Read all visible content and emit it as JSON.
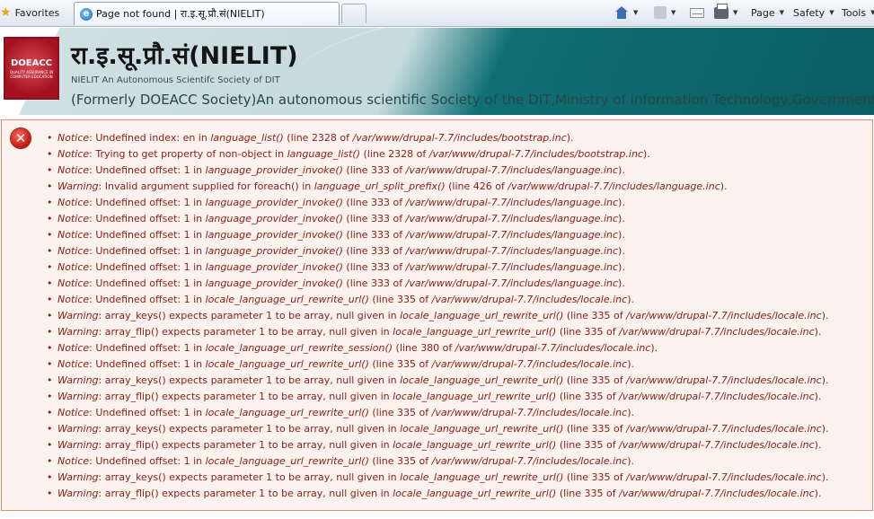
{
  "browser": {
    "favorites_label": "Favorites",
    "tab_title": "Page not found | रा.इ.सू.प्रौ.सं(NIELIT)",
    "commands": {
      "page_label": "Page",
      "safety_label": "Safety",
      "tools_label": "Tools"
    }
  },
  "site": {
    "logo_text": "DOEACC",
    "logo_subtext": "QUALITY ASSURANCE IN COMPUTER EDUCATION",
    "title": "रा.इ.सू.प्रौ.सं(NIELIT)",
    "slogan": "NIELIT An Autonomous Scientifc Society of DIT",
    "description": "(Formerly DOEACC Society)An autonomous scientific Society of the DIT,Ministry of Information Technology,Government of In"
  },
  "error_messages": [
    {
      "level": "Notice",
      "text": ": Undefined index: en in ",
      "func": "language_list()",
      "loc": " (line ",
      "line": "2328",
      "of": " of ",
      "file": "/var/www/drupal-7.7/includes/bootstrap.inc",
      "end": ")."
    },
    {
      "level": "Notice",
      "text": ": Trying to get property of non-object in ",
      "func": "language_list()",
      "loc": " (line ",
      "line": "2328",
      "of": " of ",
      "file": "/var/www/drupal-7.7/includes/bootstrap.inc",
      "end": ")."
    },
    {
      "level": "Notice",
      "text": ": Undefined offset: 1 in ",
      "func": "language_provider_invoke()",
      "loc": " (line ",
      "line": "333",
      "of": " of ",
      "file": "/var/www/drupal-7.7/includes/language.inc",
      "end": ")."
    },
    {
      "level": "Warning",
      "text": ": Invalid argument supplied for foreach() in ",
      "func": "language_url_split_prefix()",
      "loc": " (line ",
      "line": "426",
      "of": " of ",
      "file": "/var/www/drupal-7.7/includes/language.inc",
      "end": ")."
    },
    {
      "level": "Notice",
      "text": ": Undefined offset: 1 in ",
      "func": "language_provider_invoke()",
      "loc": " (line ",
      "line": "333",
      "of": " of ",
      "file": "/var/www/drupal-7.7/includes/language.inc",
      "end": ")."
    },
    {
      "level": "Notice",
      "text": ": Undefined offset: 1 in ",
      "func": "language_provider_invoke()",
      "loc": " (line ",
      "line": "333",
      "of": " of ",
      "file": "/var/www/drupal-7.7/includes/language.inc",
      "end": ")."
    },
    {
      "level": "Notice",
      "text": ": Undefined offset: 1 in ",
      "func": "language_provider_invoke()",
      "loc": " (line ",
      "line": "333",
      "of": " of ",
      "file": "/var/www/drupal-7.7/includes/language.inc",
      "end": ")."
    },
    {
      "level": "Notice",
      "text": ": Undefined offset: 1 in ",
      "func": "language_provider_invoke()",
      "loc": " (line ",
      "line": "333",
      "of": " of ",
      "file": "/var/www/drupal-7.7/includes/language.inc",
      "end": ")."
    },
    {
      "level": "Notice",
      "text": ": Undefined offset: 1 in ",
      "func": "language_provider_invoke()",
      "loc": " (line ",
      "line": "333",
      "of": " of ",
      "file": "/var/www/drupal-7.7/includes/language.inc",
      "end": ")."
    },
    {
      "level": "Notice",
      "text": ": Undefined offset: 1 in ",
      "func": "language_provider_invoke()",
      "loc": " (line ",
      "line": "333",
      "of": " of ",
      "file": "/var/www/drupal-7.7/includes/language.inc",
      "end": ")."
    },
    {
      "level": "Notice",
      "text": ": Undefined offset: 1 in ",
      "func": "locale_language_url_rewrite_url()",
      "loc": " (line ",
      "line": "335",
      "of": " of ",
      "file": "/var/www/drupal-7.7/includes/locale.inc",
      "end": ")."
    },
    {
      "level": "Warning",
      "text": ": array_keys() expects parameter 1 to be array, null given in ",
      "func": "locale_language_url_rewrite_url()",
      "loc": " (line ",
      "line": "335",
      "of": " of ",
      "file": "/var/www/drupal-7.7/includes/locale.inc",
      "end": ")."
    },
    {
      "level": "Warning",
      "text": ": array_flip() expects parameter 1 to be array, null given in ",
      "func": "locale_language_url_rewrite_url()",
      "loc": " (line ",
      "line": "335",
      "of": " of ",
      "file": "/var/www/drupal-7.7/includes/locale.inc",
      "end": ")."
    },
    {
      "level": "Notice",
      "text": ": Undefined offset: 1 in ",
      "func": "locale_language_url_rewrite_session()",
      "loc": " (line ",
      "line": "380",
      "of": " of ",
      "file": "/var/www/drupal-7.7/includes/locale.inc",
      "end": ")."
    },
    {
      "level": "Notice",
      "text": ": Undefined offset: 1 in ",
      "func": "locale_language_url_rewrite_url()",
      "loc": " (line ",
      "line": "335",
      "of": " of ",
      "file": "/var/www/drupal-7.7/includes/locale.inc",
      "end": ")."
    },
    {
      "level": "Warning",
      "text": ": array_keys() expects parameter 1 to be array, null given in ",
      "func": "locale_language_url_rewrite_url()",
      "loc": " (line ",
      "line": "335",
      "of": " of ",
      "file": "/var/www/drupal-7.7/includes/locale.inc",
      "end": ")."
    },
    {
      "level": "Warning",
      "text": ": array_flip() expects parameter 1 to be array, null given in ",
      "func": "locale_language_url_rewrite_url()",
      "loc": " (line ",
      "line": "335",
      "of": " of ",
      "file": "/var/www/drupal-7.7/includes/locale.inc",
      "end": ")."
    },
    {
      "level": "Notice",
      "text": ": Undefined offset: 1 in ",
      "func": "locale_language_url_rewrite_url()",
      "loc": " (line ",
      "line": "335",
      "of": " of ",
      "file": "/var/www/drupal-7.7/includes/locale.inc",
      "end": ")."
    },
    {
      "level": "Warning",
      "text": ": array_keys() expects parameter 1 to be array, null given in ",
      "func": "locale_language_url_rewrite_url()",
      "loc": " (line ",
      "line": "335",
      "of": " of ",
      "file": "/var/www/drupal-7.7/includes/locale.inc",
      "end": ")."
    },
    {
      "level": "Warning",
      "text": ": array_flip() expects parameter 1 to be array, null given in ",
      "func": "locale_language_url_rewrite_url()",
      "loc": " (line ",
      "line": "335",
      "of": " of ",
      "file": "/var/www/drupal-7.7/includes/locale.inc",
      "end": ")."
    },
    {
      "level": "Notice",
      "text": ": Undefined offset: 1 in ",
      "func": "locale_language_url_rewrite_url()",
      "loc": " (line ",
      "line": "335",
      "of": " of ",
      "file": "/var/www/drupal-7.7/includes/locale.inc",
      "end": ")."
    },
    {
      "level": "Warning",
      "text": ": array_keys() expects parameter 1 to be array, null given in ",
      "func": "locale_language_url_rewrite_url()",
      "loc": " (line ",
      "line": "335",
      "of": " of ",
      "file": "/var/www/drupal-7.7/includes/locale.inc",
      "end": ")."
    },
    {
      "level": "Warning",
      "text": ": array_flip() expects parameter 1 to be array, null given in ",
      "func": "locale_language_url_rewrite_url()",
      "loc": " (line ",
      "line": "335",
      "of": " of ",
      "file": "/var/www/drupal-7.7/includes/locale.inc",
      "end": ")."
    }
  ],
  "colors": {
    "error_text": "#8b1c12",
    "error_background": "#fcf2ee",
    "error_border": "#e08b7a",
    "header_teal": "#0f6f74"
  },
  "icons": [
    "star-icon",
    "browser-tab-icon",
    "home-icon",
    "feed-icon",
    "mail-icon",
    "print-icon",
    "error-icon"
  ]
}
